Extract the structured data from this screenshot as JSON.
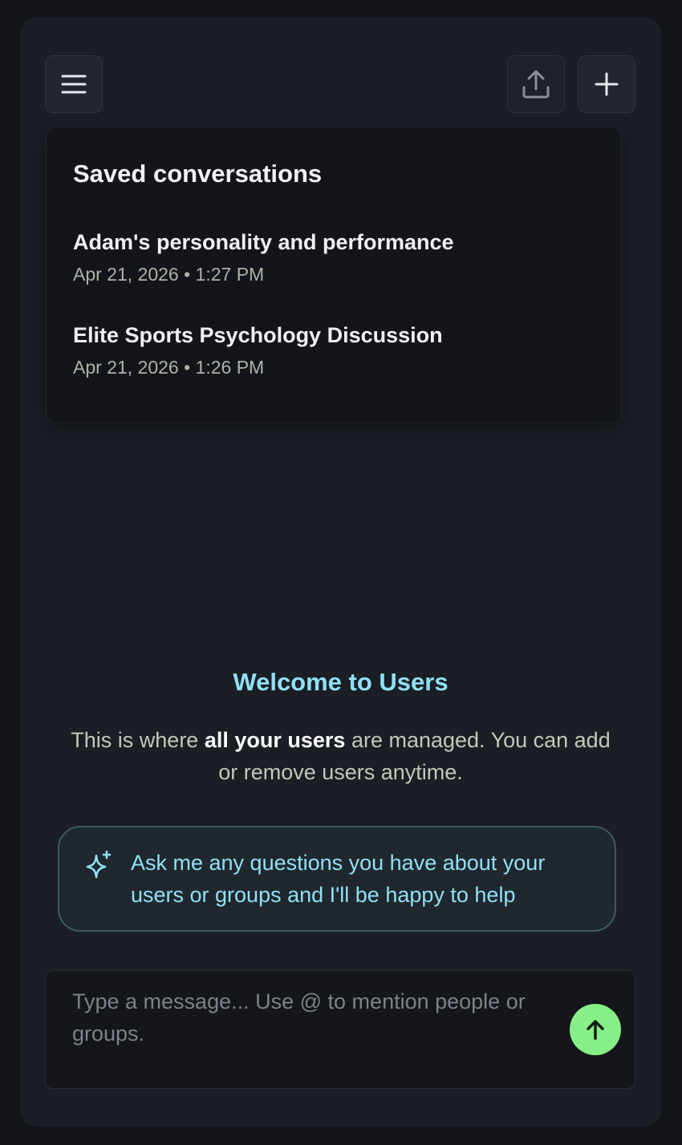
{
  "toolbar": {
    "menu_icon": "hamburger-menu-icon",
    "export_icon": "share-upload-icon",
    "new_icon": "plus-icon"
  },
  "saved": {
    "title": "Saved conversations",
    "items": [
      {
        "title": "Adam's personality and performance",
        "date": "Apr 21, 2026 • 1:27 PM"
      },
      {
        "title": "Elite Sports Psychology Discussion",
        "date": "Apr 21, 2026 • 1:26 PM"
      }
    ]
  },
  "welcome": {
    "title": "Welcome to Users",
    "text_before": "This is where ",
    "text_bold": "all your users",
    "text_after": " are managed. You can add or remove users anytime."
  },
  "hint": {
    "icon": "sparkle-icon",
    "text": "Ask me any questions you have about your users or groups and I'll be happy to help"
  },
  "composer": {
    "placeholder": "Type a message... Use @ to mention people or groups.",
    "value": "",
    "send_icon": "arrow-up-icon"
  },
  "colors": {
    "accent_cyan": "#8fe1f4",
    "send_green": "#86ef88",
    "panel_bg": "#1b1e25"
  }
}
